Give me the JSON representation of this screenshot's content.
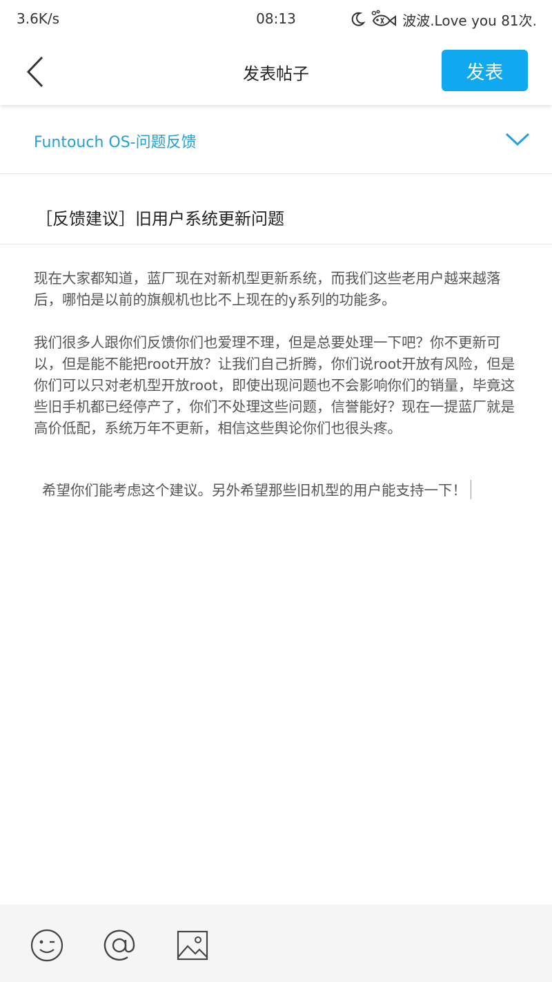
{
  "status_bar": {
    "speed": "3.6K/s",
    "time": "08:13",
    "carrier": "波波.Love you 81次.",
    "icons": [
      "moon-icon",
      "fish-icon"
    ]
  },
  "header": {
    "back_icon": "chevron-left-icon",
    "title": "发表帖子",
    "publish_label": "发表",
    "accent_color": "#10a8ef"
  },
  "category": {
    "label": "Funtouch OS-问题反馈",
    "icon": "chevron-down-icon",
    "color": "#23a0d6"
  },
  "post": {
    "title": "［反馈建议］旧用户系统更新问题",
    "paragraphs": [
      "现在大家都知道，蓝厂现在对新机型更新系统，而我们这些老用户越来越落后，哪怕是以前的旗舰机也比不上现在的y系列的功能多。",
      "我们很多人跟你们反馈你们也爱理不理，但是总要处理一下吧？你不更新可以，但是能不能把root开放？让我们自己折腾，你们说root开放有风险，但是你们可以只对老机型开放root，即使出现问题也不会影响你们的销量，毕竟这些旧手机都已经停产了，你们不处理这些问题，信誉能好？现在一提蓝厂就是高价低配，系统万年不更新，相信这些舆论你们也很头疼。",
      "希望你们能考虑这个建议。另外希望那些旧机型的用户能支持一下！"
    ]
  },
  "toolbar": {
    "icons": [
      "emoji-icon",
      "at-mention-icon",
      "image-icon"
    ]
  }
}
